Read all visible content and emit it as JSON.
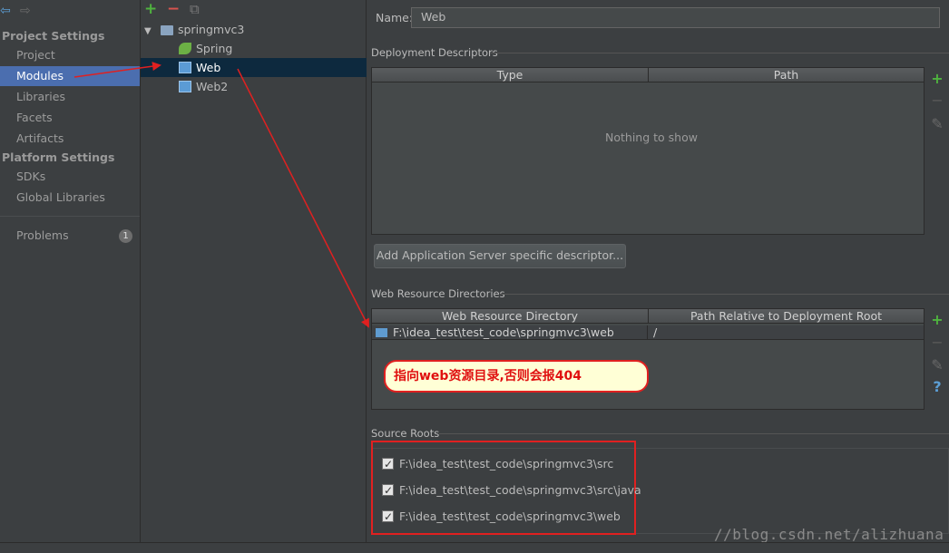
{
  "nav": {
    "back": "⇦",
    "forward": "⇨",
    "project_settings": "Project Settings",
    "items": [
      {
        "label": "Project"
      },
      {
        "label": "Modules"
      },
      {
        "label": "Libraries"
      },
      {
        "label": "Facets"
      },
      {
        "label": "Artifacts"
      }
    ],
    "platform_settings": "Platform Settings",
    "platform_items": [
      {
        "label": "SDKs"
      },
      {
        "label": "Global Libraries"
      }
    ],
    "problems": {
      "label": "Problems",
      "count": "1"
    }
  },
  "tree": {
    "add": "+",
    "remove": "−",
    "copy": "⧉",
    "root": "springmvc3",
    "children": [
      {
        "label": "Spring"
      },
      {
        "label": "Web"
      },
      {
        "label": "Web2"
      }
    ]
  },
  "main": {
    "name_label": "Name:",
    "name_value": "Web",
    "deployment": {
      "title": "Deployment Descriptors",
      "columns": [
        "Type",
        "Path"
      ],
      "empty": "Nothing to show",
      "add_button": "Add Application Server specific descriptor..."
    },
    "web_resources": {
      "title": "Web Resource Directories",
      "columns": [
        "Web Resource Directory",
        "Path Relative to Deployment Root"
      ],
      "rows": [
        {
          "dir": "F:\\idea_test\\test_code\\springmvc3\\web",
          "path": "/"
        }
      ],
      "annotation": "指向web资源目录,否则会报404"
    },
    "source_roots": {
      "title": "Source Roots",
      "items": [
        {
          "path": "F:\\idea_test\\test_code\\springmvc3\\src",
          "checked": true
        },
        {
          "path": "F:\\idea_test\\test_code\\springmvc3\\src\\java",
          "checked": true
        },
        {
          "path": "F:\\idea_test\\test_code\\springmvc3\\web",
          "checked": true
        }
      ]
    },
    "tools": {
      "add": "+",
      "remove": "−",
      "edit": "✎",
      "help": "?"
    }
  },
  "watermark": "//blog.csdn.net/alizhuana",
  "colors": {
    "background": "#3c3f41",
    "selection": "#4b6eaf",
    "tree_selection": "#0d293e",
    "add_green": "#4fb33f",
    "remove_red": "#d9534f",
    "annotation_red": "#e02020",
    "callout_bg": "#ffffd6"
  }
}
